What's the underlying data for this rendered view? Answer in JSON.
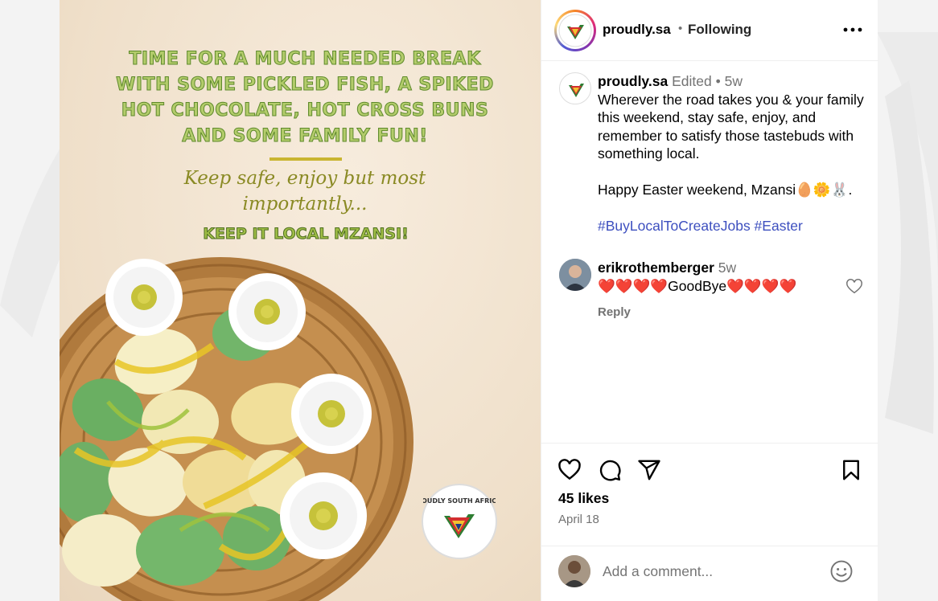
{
  "post_image": {
    "headline": "TIME FOR A MUCH NEEDED BREAK WITH SOME PICKLED FISH, A SPIKED HOT CHOCOLATE, HOT CROSS BUNS AND SOME FAMILY FUN!",
    "script_line": "Keep safe, enjoy but most importantly...",
    "keep_local": "KEEP IT LOCAL MZANSI!",
    "badge_text": "PROUDLY SOUTH AFRICAN"
  },
  "header": {
    "username": "proudly.sa",
    "separator": "•",
    "follow_status": "Following",
    "more_icon": "more-horizontal-icon"
  },
  "caption": {
    "username": "proudly.sa",
    "edited": "Edited",
    "separator": "•",
    "age": "5w",
    "text": "Wherever the road takes you & your family this weekend, stay safe, enjoy, and remember to satisfy those tastebuds with something local.\n\nHappy Easter weekend, Mzansi🥚🌼🐰.\n\n",
    "hashtags": "#BuyLocalToCreateJobs #Easter"
  },
  "comment": {
    "username": "erikrothemberger",
    "age": "5w",
    "text": "❤️❤️❤️❤️GoodBye❤️❤️❤️❤️",
    "reply_label": "Reply"
  },
  "actions": {
    "likes": "45 likes",
    "date": "April 18"
  },
  "comment_input": {
    "placeholder": "Add a comment..."
  },
  "colors": {
    "headline_green": "#b3cc6b",
    "script_olive": "#8a8a24",
    "hashtag_blue": "#3d4fbf",
    "muted_gray": "#737373"
  }
}
